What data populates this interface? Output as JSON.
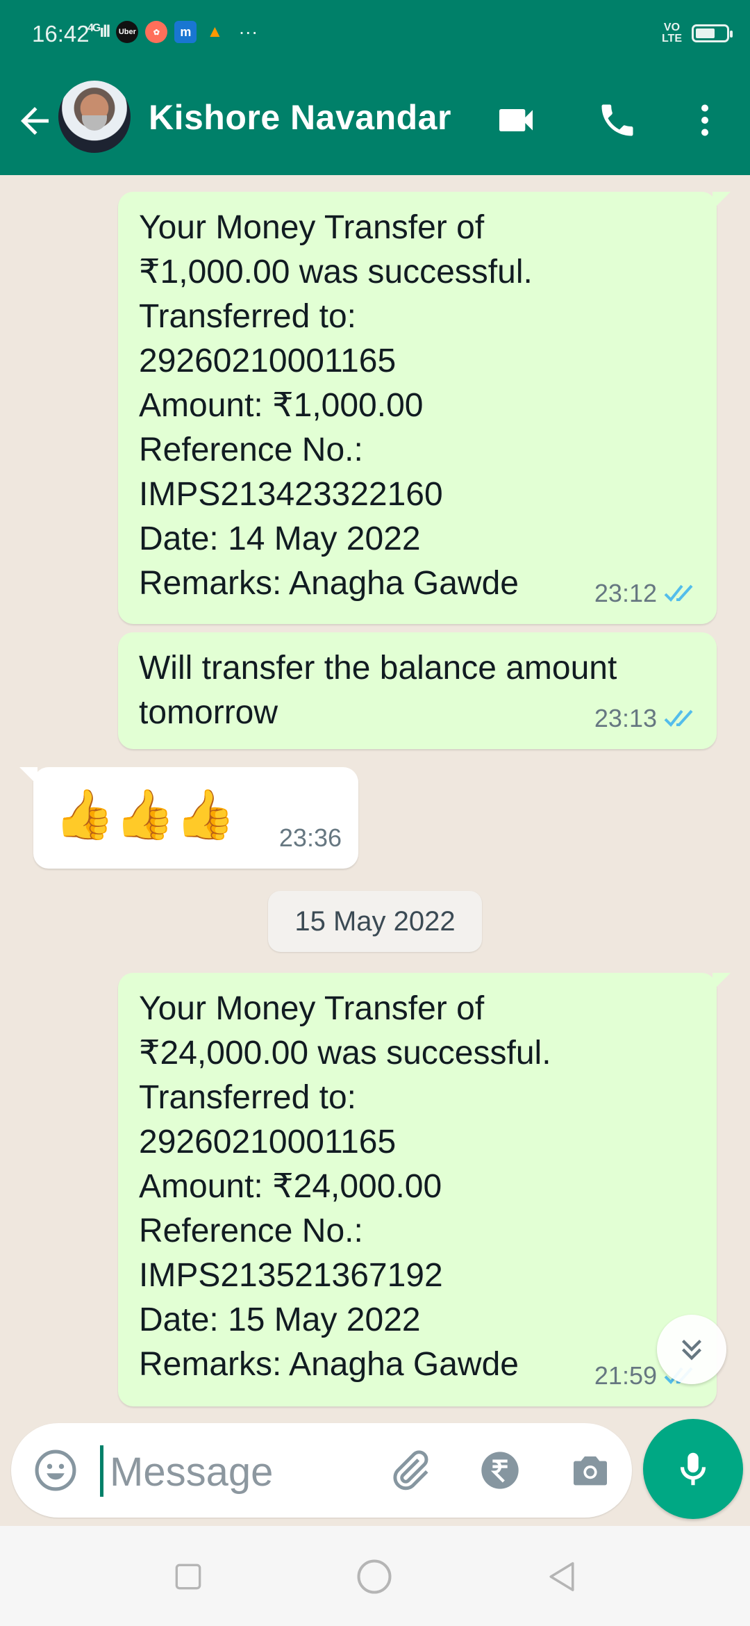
{
  "status_bar": {
    "time": "16:42",
    "network": "4G",
    "app_icons": [
      "uber-icon",
      "game-icon",
      "m-app-icon",
      "triangle-app-icon"
    ],
    "more": "···",
    "volte": "VO LTE",
    "battery_level": 0.55
  },
  "header": {
    "contact_name": "Kishore Navandar",
    "icons": [
      "back-arrow-icon",
      "video-call-icon",
      "voice-call-icon",
      "more-vertical-icon"
    ],
    "accent_color": "#008069"
  },
  "chat": {
    "messages": [
      {
        "direction": "outgoing",
        "text": "Your Money Transfer of\n₹1,000.00 was successful.\nTransferred to:\n29260210001165\nAmount: ₹1,000.00\nReference No.:\nIMPS213423322160\nDate: 14 May 2022\nRemarks: Anagha Gawde",
        "time": "23:12",
        "status": "read"
      },
      {
        "direction": "outgoing",
        "text": "Will transfer the balance amount\ntomorrow",
        "time": "23:13",
        "status": "read"
      },
      {
        "direction": "incoming",
        "text": "👍👍👍",
        "time": "23:36"
      },
      {
        "direction": "outgoing",
        "text": "Your Money Transfer of\n₹24,000.00 was successful.\nTransferred to:\n29260210001165\nAmount: ₹24,000.00\nReference No.:\nIMPS213521367192\nDate: 15 May 2022\nRemarks: Anagha Gawde",
        "time": "21:59",
        "status": "read"
      }
    ],
    "date_separator": "15 May 2022"
  },
  "composer": {
    "placeholder": "Message",
    "icons": [
      "emoji-icon",
      "attach-icon",
      "rupee-payment-icon",
      "camera-icon",
      "mic-icon"
    ]
  },
  "nav": {
    "buttons": [
      "recents-icon",
      "home-icon",
      "back-icon"
    ]
  },
  "colors": {
    "outgoing_bubble": "#e2ffd4",
    "incoming_bubble": "#ffffff",
    "read_tick": "#53bdeb",
    "mic_button": "#00a884"
  }
}
